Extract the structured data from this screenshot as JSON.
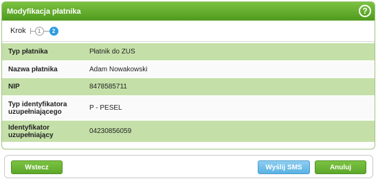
{
  "dialog": {
    "title": "Modyfikacja płatnika",
    "help_label": "?"
  },
  "steps": {
    "label": "Krok",
    "items": [
      "1",
      "2"
    ],
    "active": 2
  },
  "fields": [
    {
      "label": "Typ płatnika",
      "value": "Płatnik do ZUS"
    },
    {
      "label": "Nazwa płatnika",
      "value": "Adam Nowakowski"
    },
    {
      "label": "NIP",
      "value": "8478585711"
    },
    {
      "label": "Typ identyfikatora uzupełniającego",
      "value": "P - PESEL"
    },
    {
      "label": "Identyfikator uzupełniający",
      "value": "04230856059"
    }
  ],
  "footer": {
    "back_label": "Wstecz",
    "sms_label": "Wyślij SMS",
    "cancel_label": "Anuluj"
  },
  "colors": {
    "title_green": "#5faa2a",
    "row_green": "#c4e0a8",
    "active_step": "#2f9be0",
    "sms_blue": "#6cbde8"
  }
}
